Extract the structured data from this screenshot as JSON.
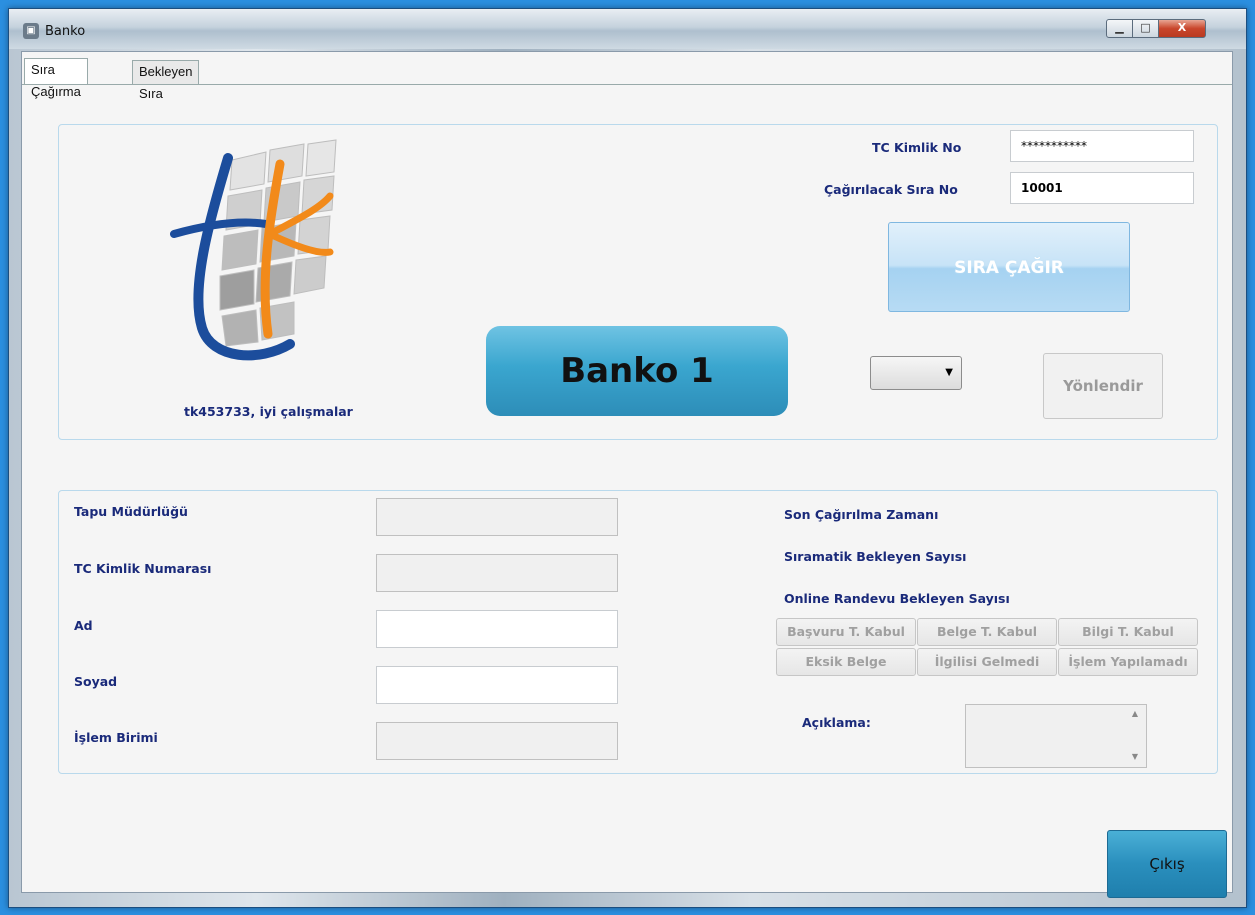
{
  "window": {
    "title": "Banko",
    "controls": {
      "minimize": "▁",
      "maximize": "□",
      "close": "X"
    }
  },
  "tabs": [
    {
      "label": "Sıra Çağırma",
      "active": true
    },
    {
      "label": "Bekleyen Sıra",
      "active": false
    }
  ],
  "top_panel": {
    "tc_label": "TC Kimlik No",
    "tc_value": "***********",
    "sira_label": "Çağırılacak Sıra No",
    "sira_value": "10001",
    "call_button": "SIRA ÇAĞIR",
    "banko_label": "Banko 1",
    "welcome": "tk453733, iyi çalışmalar",
    "redirect_select": "",
    "redirect_button": "Yönlendir"
  },
  "bottom_panel": {
    "fields": {
      "tapu_mudurlugu": {
        "label": "Tapu Müdürlüğü",
        "value": ""
      },
      "tc_numarasi": {
        "label": "TC Kimlik Numarası",
        "value": ""
      },
      "ad": {
        "label": "Ad",
        "value": ""
      },
      "soyad": {
        "label": "Soyad",
        "value": ""
      },
      "islem_birimi": {
        "label": "İşlem Birimi",
        "value": ""
      }
    },
    "info": {
      "son_cagirilma": "Son Çağırılma Zamanı",
      "siramatik": "Sıramatik Bekleyen Sayısı",
      "online": "Online Randevu Bekleyen Sayısı"
    },
    "buttons": [
      "Başvuru T. Kabul",
      "Belge T. Kabul",
      "Bilgi T. Kabul",
      "Eksik Belge",
      "İlgilisi Gelmedi",
      "İşlem Yapılamadı"
    ],
    "aciklama_label": "Açıklama:",
    "aciklama_value": ""
  },
  "exit_button": "Çıkış",
  "colors": {
    "label_text": "#1a2a7a",
    "accent_blue": "#2d8db8",
    "logo_blue": "#1c4d9c",
    "logo_orange": "#f28a1a"
  },
  "icons": [
    "app-icon",
    "dropdown-arrow-icon",
    "scroll-up-icon",
    "scroll-down-icon"
  ]
}
